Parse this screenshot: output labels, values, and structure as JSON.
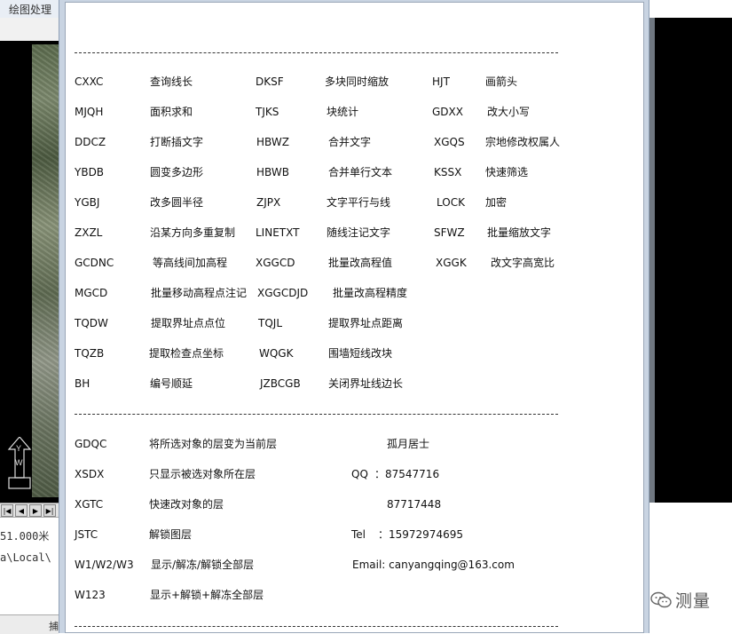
{
  "background_app": {
    "title": "绘图处理",
    "scale_text": "51.000米",
    "path_text": "a\\Local\\",
    "status_text": "捕",
    "ucs_labels": [
      "Y",
      "W"
    ]
  },
  "commands": [
    {
      "code": "CXXC",
      "desc": "查询线长"
    },
    {
      "code": "DKSF",
      "desc": "多块同时缩放"
    },
    {
      "code": "HJT",
      "desc": "画箭头"
    },
    {
      "code": "MJQH",
      "desc": "面积求和"
    },
    {
      "code": "TJKS",
      "desc": "块统计"
    },
    {
      "code": "GDXX",
      "desc": "改大小写"
    },
    {
      "code": "DDCZ",
      "desc": "打断插文字"
    },
    {
      "code": "HBWZ",
      "desc": "合并文字"
    },
    {
      "code": "XGQS",
      "desc": "宗地修改权属人"
    },
    {
      "code": "YBDB",
      "desc": "圆变多边形"
    },
    {
      "code": "HBWB",
      "desc": "合并单行文本"
    },
    {
      "code": "KSSX",
      "desc": "快速筛选"
    },
    {
      "code": "YGBJ",
      "desc": "改多圆半径"
    },
    {
      "code": "ZJPX",
      "desc": "文字平行与线"
    },
    {
      "code": "LOCK",
      "desc": "加密"
    },
    {
      "code": "ZXZL",
      "desc": "沿某方向多重复制"
    },
    {
      "code": "LINETXT",
      "desc": "随线注记文字"
    },
    {
      "code": "SFWZ",
      "desc": "批量缩放文字"
    },
    {
      "code": "GCDNC",
      "desc": "等高线间加高程"
    },
    {
      "code": "XGGCD",
      "desc": "批量改高程值"
    },
    {
      "code": "XGGK",
      "desc": "改文字高宽比"
    },
    {
      "code": "MGCD",
      "desc": "批量移动高程点注记"
    },
    {
      "code": "XGGCDJD",
      "desc": "批量改高程精度"
    },
    {
      "code": "TQDW",
      "desc": "提取界址点点位"
    },
    {
      "code": "TQJL",
      "desc": "提取界址点距离"
    },
    {
      "code": "TQZB",
      "desc": "提取检查点坐标"
    },
    {
      "code": "WQGK",
      "desc": "围墙短线改块"
    },
    {
      "code": "BH",
      "desc": "编号顺延"
    },
    {
      "code": "JZBCGB",
      "desc": "关闭界址线边长"
    }
  ],
  "layer_commands": [
    {
      "code": "GDQC",
      "desc": "将所选对象的层变为当前层"
    },
    {
      "code": "XSDX",
      "desc": "只显示被选对象所在层"
    },
    {
      "code": "XGTC",
      "desc": "快速改对象的层"
    },
    {
      "code": "JSTC",
      "desc": "解锁图层"
    },
    {
      "code": "W1/W2/W3",
      "desc": "显示/解冻/解锁全部层"
    },
    {
      "code": "W123",
      "desc": "显示+解锁+解冻全部层"
    }
  ],
  "contact": {
    "author": "孤月居士",
    "qq_label": "QQ",
    "qq_value": "：87547716",
    "qq_value2": "87717448",
    "tel_label": "Tel",
    "tel_value": "：15972974695",
    "email": "Email: canyangqing@163.com"
  },
  "watermark": {
    "text": "测量",
    "icon": "wechat-icon"
  },
  "separator": "----------------------------------------------------------------------------------------------------------------------------"
}
